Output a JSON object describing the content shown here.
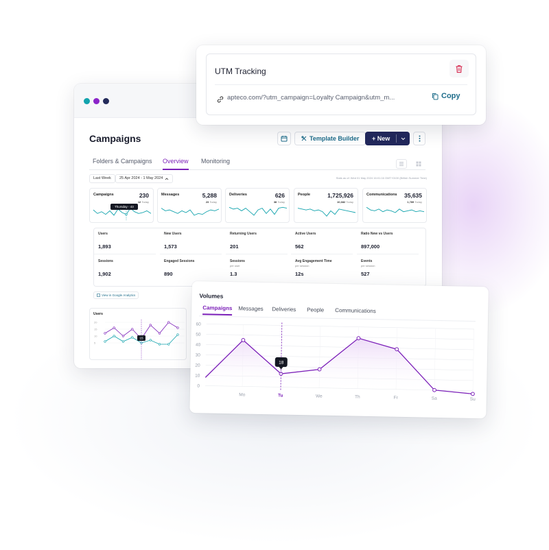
{
  "window": {
    "page_title": "Campaigns",
    "buttons": {
      "template_builder": "Template Builder",
      "new": "+ New"
    },
    "tabs": [
      "Folders & Campaigns",
      "Overview",
      "Monitoring"
    ],
    "active_tab": "Overview",
    "filters": {
      "period": "Last Week",
      "date_range": "25 Apr 2024 - 1 May 2024"
    },
    "stats_note": "Stats as of: Wed 01 May 2024 16:01:16 GMT+0100 (British Summer Time)"
  },
  "metrics": [
    {
      "label": "Campaigns",
      "value": "230",
      "sub_value": "12",
      "sub_label": "Today",
      "tooltip": "Thursday - 43",
      "spark": [
        10,
        6,
        8,
        5,
        9,
        4,
        11,
        7,
        5,
        12,
        8,
        6,
        7,
        9,
        6
      ]
    },
    {
      "label": "Messages",
      "value": "5,288",
      "sub_value": "23",
      "sub_label": "Today",
      "spark": [
        12,
        9,
        10,
        8,
        6,
        9,
        7,
        10,
        4,
        6,
        5,
        8,
        10,
        9,
        11
      ]
    },
    {
      "label": "Deliveries",
      "value": "626",
      "sub_value": "38",
      "sub_label": "Today",
      "spark": [
        13,
        11,
        12,
        9,
        12,
        8,
        4,
        10,
        12,
        6,
        11,
        5,
        12,
        13,
        12
      ]
    },
    {
      "label": "People",
      "value": "1,725,926",
      "sub_value": "10,682",
      "sub_label": "Today",
      "spark": [
        12,
        11,
        10,
        11,
        9,
        10,
        8,
        3,
        9,
        5,
        11,
        10,
        9,
        8,
        7
      ]
    },
    {
      "label": "Communications",
      "value": "35,635",
      "sub_value": "1,789",
      "sub_label": "Today",
      "spark": [
        13,
        10,
        9,
        11,
        8,
        10,
        9,
        7,
        11,
        8,
        9,
        10,
        8,
        9,
        8
      ]
    }
  ],
  "analytics": {
    "cells": [
      {
        "label": "Users",
        "sub": "",
        "value": "1,893"
      },
      {
        "label": "New Users",
        "sub": "",
        "value": "1,573"
      },
      {
        "label": "Returning Users",
        "sub": "",
        "value": "201"
      },
      {
        "label": "Active Users",
        "sub": "",
        "value": "562"
      },
      {
        "label": "Ratio New vs Users",
        "sub": "",
        "value": "897,000"
      },
      {
        "label": "Sessions",
        "sub": "",
        "value": "1,902"
      },
      {
        "label": "Engaged Sessions",
        "sub": "",
        "value": "890"
      },
      {
        "label": "Sessions",
        "sub": "per user",
        "value": "1.3"
      },
      {
        "label": "Avg Engagement Time",
        "sub": "per session",
        "value": "12s"
      },
      {
        "label": "Events",
        "sub": "per session",
        "value": "527"
      }
    ],
    "link": "View in Google Analytics"
  },
  "users_chart": {
    "title": "Users",
    "yticks": [
      "20",
      "15",
      "10",
      "5"
    ],
    "tooltip": "15",
    "series_purple": [
      12,
      16,
      10,
      15,
      8,
      18,
      12,
      20,
      16
    ],
    "series_teal": [
      6,
      10,
      6,
      9,
      5,
      7,
      4,
      4,
      11
    ]
  },
  "utm": {
    "title": "UTM Tracking",
    "url": "apteco.com/?utm_campaign=Loyalty Campaign&utm_m...",
    "copy_label": "Copy"
  },
  "volumes": {
    "title": "Volumes",
    "tabs": [
      "Campaigns",
      "Messages",
      "Deliveries",
      "People",
      "Communications"
    ],
    "active_tab": "Campaigns",
    "tooltip": "18"
  },
  "chart_data": {
    "type": "area",
    "title": "Volumes",
    "categories": [
      "Mo",
      "Tu",
      "We",
      "Th",
      "Fr",
      "Sa",
      "Su"
    ],
    "series": [
      {
        "values": [
          45,
          13,
          18,
          49,
          39,
          0,
          -3
        ]
      }
    ],
    "start_value": 8,
    "highlighted": "Tu",
    "ylim": [
      0,
      60
    ],
    "yticks": [
      0,
      10,
      20,
      30,
      40,
      50,
      60
    ],
    "grid": true,
    "colors": {
      "line": "#7b1fb8",
      "fill": "#ecd9f7",
      "grid": "#e9ebef"
    }
  },
  "colors": {
    "accent": "#7b1fb8",
    "teal": "#12a3ad",
    "navy": "#22285c",
    "link": "#1d6c8a",
    "delete": "#d6294f"
  }
}
